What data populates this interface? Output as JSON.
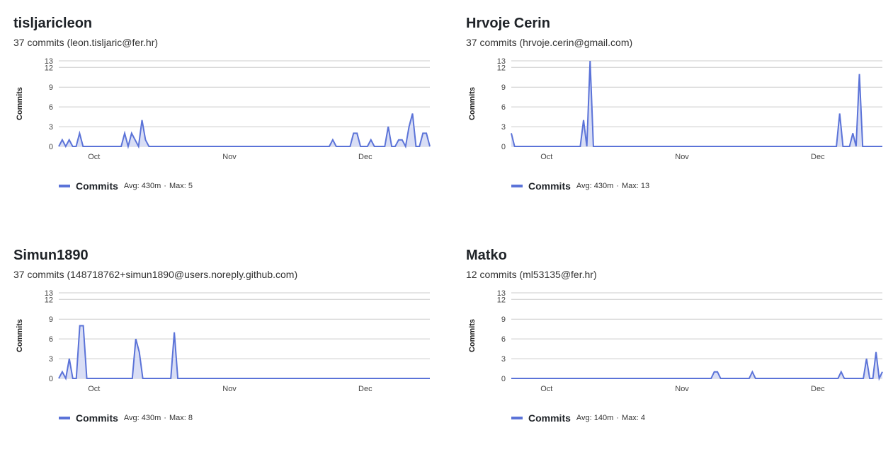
{
  "colors": {
    "series": "#5b73d8",
    "fill": "#d9def5",
    "grid": "#cccccc",
    "text": "#1f2328"
  },
  "authors": [
    {
      "name": "tisljaricleon",
      "subtitle": "37 commits (leon.tisljaric@fer.hr)",
      "legend": {
        "name": "Commits",
        "avg": "Avg: 430m",
        "sep": "·",
        "max": "Max: 5"
      }
    },
    {
      "name": "Hrvoje Cerin",
      "subtitle": "37 commits (hrvoje.cerin@gmail.com)",
      "legend": {
        "name": "Commits",
        "avg": "Avg: 430m",
        "sep": "·",
        "max": "Max: 13"
      }
    },
    {
      "name": "Simun1890",
      "subtitle": "37 commits (148718762+simun1890@users.noreply.github.com)",
      "legend": {
        "name": "Commits",
        "avg": "Avg: 430m",
        "sep": "·",
        "max": "Max: 8"
      }
    },
    {
      "name": "Matko",
      "subtitle": "12 commits (ml53135@fer.hr)",
      "legend": {
        "name": "Commits",
        "avg": "Avg: 140m",
        "sep": "·",
        "max": "Max: 4"
      }
    }
  ],
  "chart_data": [
    {
      "type": "area",
      "series": [
        {
          "name": "Commits",
          "values": [
            0,
            1,
            0,
            1,
            0,
            0,
            2,
            0,
            0,
            0,
            0,
            0,
            0,
            0,
            0,
            0,
            0,
            0,
            0,
            2,
            0,
            2,
            1,
            0,
            4,
            1,
            0,
            0,
            0,
            0,
            0,
            0,
            0,
            0,
            0,
            0,
            0,
            0,
            0,
            0,
            0,
            0,
            0,
            0,
            0,
            0,
            0,
            0,
            0,
            0,
            0,
            0,
            0,
            0,
            0,
            0,
            0,
            0,
            0,
            0,
            0,
            0,
            0,
            0,
            0,
            0,
            0,
            0,
            0,
            0,
            0,
            0,
            0,
            0,
            0,
            0,
            0,
            0,
            0,
            1,
            0,
            0,
            0,
            0,
            0,
            2,
            2,
            0,
            0,
            0,
            1,
            0,
            0,
            0,
            0,
            3,
            0,
            0,
            1,
            1,
            0,
            3,
            5,
            0,
            0,
            2,
            2,
            0
          ]
        }
      ],
      "x_ticks": [
        "Oct",
        "Nov",
        "Dec"
      ],
      "y_ticks": [
        0,
        3,
        6,
        9,
        12,
        13
      ],
      "ylabel": "Commits",
      "ylim": [
        0,
        13
      ],
      "grid": true,
      "legend": "bottom-left"
    },
    {
      "type": "area",
      "series": [
        {
          "name": "Commits",
          "values": [
            2,
            0,
            0,
            0,
            0,
            0,
            0,
            0,
            0,
            0,
            0,
            0,
            0,
            0,
            0,
            0,
            0,
            0,
            0,
            0,
            0,
            0,
            4,
            0,
            13,
            0,
            0,
            0,
            0,
            0,
            0,
            0,
            0,
            0,
            0,
            0,
            0,
            0,
            0,
            0,
            0,
            0,
            0,
            0,
            0,
            0,
            0,
            0,
            0,
            0,
            0,
            0,
            0,
            0,
            0,
            0,
            0,
            0,
            0,
            0,
            0,
            0,
            0,
            0,
            0,
            0,
            0,
            0,
            0,
            0,
            0,
            0,
            0,
            0,
            0,
            0,
            0,
            0,
            0,
            0,
            0,
            0,
            0,
            0,
            0,
            0,
            0,
            0,
            0,
            0,
            0,
            0,
            0,
            0,
            0,
            0,
            0,
            0,
            0,
            0,
            5,
            0,
            0,
            0,
            2,
            0,
            11,
            0,
            0,
            0,
            0,
            0,
            0,
            0
          ]
        }
      ],
      "x_ticks": [
        "Oct",
        "Nov",
        "Dec"
      ],
      "y_ticks": [
        0,
        3,
        6,
        9,
        12,
        13
      ],
      "ylabel": "Commits",
      "ylim": [
        0,
        13
      ],
      "grid": true,
      "legend": "bottom-left"
    },
    {
      "type": "area",
      "series": [
        {
          "name": "Commits",
          "values": [
            0,
            1,
            0,
            3,
            0,
            0,
            8,
            8,
            0,
            0,
            0,
            0,
            0,
            0,
            0,
            0,
            0,
            0,
            0,
            0,
            0,
            0,
            6,
            4,
            0,
            0,
            0,
            0,
            0,
            0,
            0,
            0,
            0,
            7,
            0,
            0,
            0,
            0,
            0,
            0,
            0,
            0,
            0,
            0,
            0,
            0,
            0,
            0,
            0,
            0,
            0,
            0,
            0,
            0,
            0,
            0,
            0,
            0,
            0,
            0,
            0,
            0,
            0,
            0,
            0,
            0,
            0,
            0,
            0,
            0,
            0,
            0,
            0,
            0,
            0,
            0,
            0,
            0,
            0,
            0,
            0,
            0,
            0,
            0,
            0,
            0,
            0,
            0,
            0,
            0,
            0,
            0,
            0,
            0,
            0,
            0,
            0,
            0,
            0,
            0,
            0,
            0,
            0,
            0,
            0,
            0,
            0
          ]
        }
      ],
      "x_ticks": [
        "Oct",
        "Nov",
        "Dec"
      ],
      "y_ticks": [
        0,
        3,
        6,
        9,
        12,
        13
      ],
      "ylabel": "Commits",
      "ylim": [
        0,
        13
      ],
      "grid": true,
      "legend": "bottom-left"
    },
    {
      "type": "area",
      "series": [
        {
          "name": "Commits",
          "values": [
            0,
            0,
            0,
            0,
            0,
            0,
            0,
            0,
            0,
            0,
            0,
            0,
            0,
            0,
            0,
            0,
            0,
            0,
            0,
            0,
            0,
            0,
            0,
            0,
            0,
            0,
            0,
            0,
            0,
            0,
            0,
            0,
            0,
            0,
            0,
            0,
            0,
            0,
            0,
            0,
            0,
            0,
            0,
            0,
            0,
            0,
            0,
            0,
            0,
            0,
            0,
            0,
            0,
            0,
            0,
            0,
            0,
            0,
            0,
            0,
            0,
            0,
            0,
            0,
            1,
            1,
            0,
            0,
            0,
            0,
            0,
            0,
            0,
            0,
            0,
            0,
            1,
            0,
            0,
            0,
            0,
            0,
            0,
            0,
            0,
            0,
            0,
            0,
            0,
            0,
            0,
            0,
            0,
            0,
            0,
            0,
            0,
            0,
            0,
            0,
            0,
            0,
            0,
            0,
            1,
            0,
            0,
            0,
            0,
            0,
            0,
            0,
            3,
            0,
            0,
            4,
            0,
            1
          ]
        }
      ],
      "x_ticks": [
        "Oct",
        "Nov",
        "Dec"
      ],
      "y_ticks": [
        0,
        3,
        6,
        9,
        12,
        13
      ],
      "ylabel": "Commits",
      "ylim": [
        0,
        13
      ],
      "grid": true,
      "legend": "bottom-left"
    }
  ]
}
